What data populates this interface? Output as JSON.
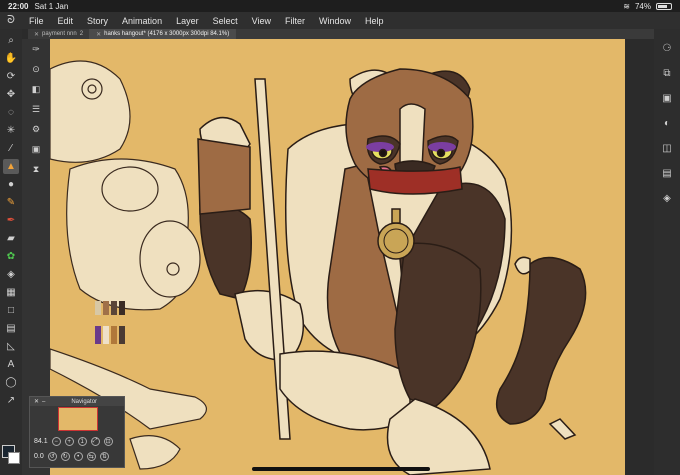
{
  "status": {
    "time": "22:00",
    "date": "Sat 1 Jan",
    "battery": "74%",
    "battery_level": 0.74
  },
  "menu": [
    "File",
    "Edit",
    "Story",
    "Animation",
    "Layer",
    "Select",
    "View",
    "Filter",
    "Window",
    "Help"
  ],
  "tabs": [
    {
      "label": "payment nnn",
      "close": "2",
      "active": false
    },
    {
      "label": "hanks hangout* (4176 x 3000px 300dpi 84.1%)",
      "close": "×",
      "active": true
    }
  ],
  "navigator": {
    "title": "Navigator",
    "zoom": "84.1",
    "rotation": "0.0"
  },
  "colors": {
    "canvas": "#e3b869",
    "accent": "#f2a33a",
    "main_color": "#1a2530",
    "sub_color": "#ffffff"
  }
}
